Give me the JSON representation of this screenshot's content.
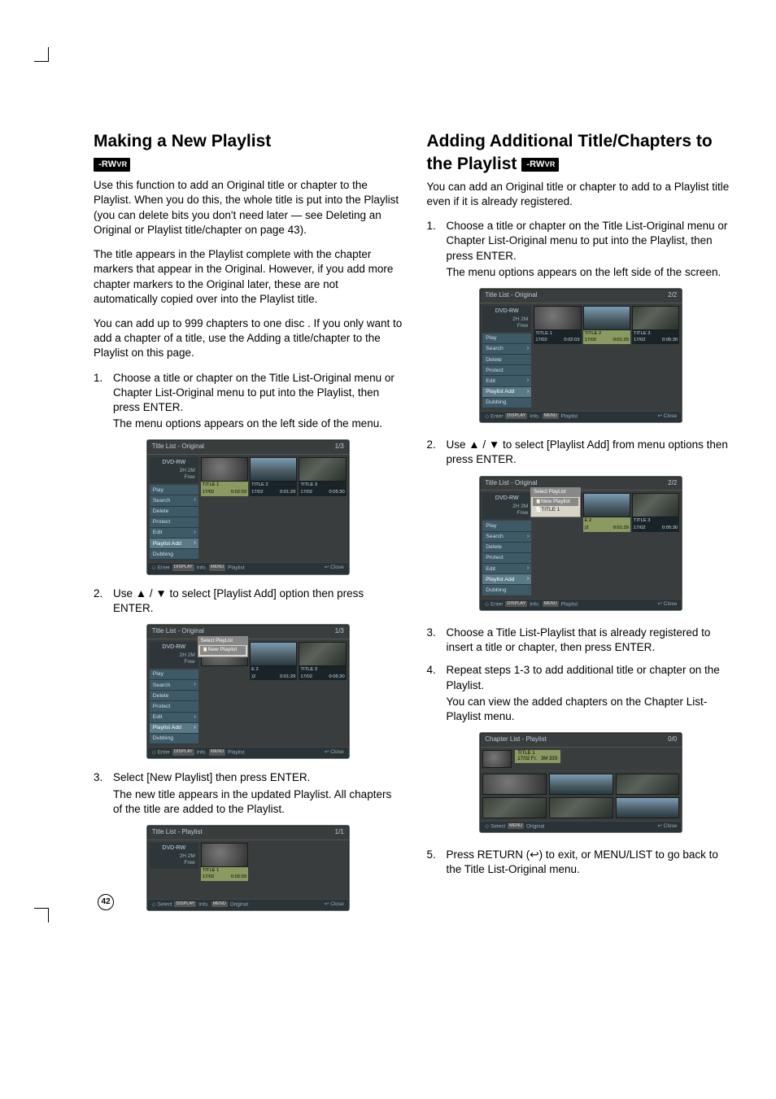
{
  "page_number": "42",
  "left": {
    "title": "Making a New Playlist",
    "badge": "-RW",
    "badge_sub": "VR",
    "p1": "Use this function to add an Original title or chapter to the Playlist. When you do this, the whole title is put into the Playlist (you can delete bits you don't need later — see Deleting an Original or Playlist title/chapter on page 43).",
    "p2": "The title appears in the Playlist complete with the chapter markers that appear in the Original. However, if you add more chapter markers to the Original later, these are not automatically copied over into the Playlist title.",
    "p3": "You can add up to 999 chapters to one disc . If you only want to add a chapter of a title, use the Adding a title/chapter to the Playlist on this page.",
    "step1_a": "Choose a title or chapter on the Title List-Original menu or Chapter List-Original menu to put into the Playlist, then press ENTER.",
    "step1_b": "The menu options appears on the left side of the menu.",
    "step2": "Use ▲ / ▼ to select [Playlist Add] option then press ENTER.",
    "step3_a": "Select [New Playlist] then press ENTER.",
    "step3_b": "The new title appears in the updated Playlist. All chapters of the title are added to the Playlist."
  },
  "right": {
    "title": "Adding Additional Title/Chapters to the Playlist",
    "badge": "-RW",
    "badge_sub": "VR",
    "p1": "You can add an Original title or chapter to add to a Playlist title even if it is already registered.",
    "step1_a": "Choose a title or chapter on the Title List-Original menu or Chapter List-Original menu to put into the Playlist, then press ENTER.",
    "step1_b": "The menu options appears on the left side of the screen.",
    "step2": "Use ▲ / ▼ to select [Playlist Add] from menu options then press ENTER.",
    "step3": "Choose a Title List-Playlist that is already registered to insert a title or chapter, then press ENTER.",
    "step4_a": "Repeat steps 1-3 to add additional title or chapter on the Playlist.",
    "step4_b": "You can view the added chapters on the Chapter List-Playlist menu.",
    "step5": "Press RETURN (↩) to exit, or MENU/LIST to go back to the Title List-Original menu."
  },
  "ui": {
    "titleListOriginal": "Title List - Original",
    "titleListPlaylist": "Title List - Playlist",
    "chapterListPlaylist": "Chapter List - Playlist",
    "page_1_3": "1/3",
    "page_2_2": "2/2",
    "page_1_1": "1/1",
    "page_0_0": "0/0",
    "disc_type": "DVD-RW",
    "disc_space": "2H 2M",
    "disc_free": "Free",
    "menu_play": "Play",
    "menu_search": "Search",
    "menu_delete": "Delete",
    "menu_protect": "Protect",
    "menu_edit": "Edit",
    "menu_playlist_add": "Playlist Add",
    "menu_dubbing": "Dubbing",
    "popup_select_playlist": "Select PlayList",
    "popup_new_playlist": "New Playlist",
    "popup_title1": "TITLE 1",
    "title1": "TITLE 1",
    "title2": "TITLE 2",
    "title3": "TITLE 3",
    "date": "17/02",
    "dur1": "0:02:03",
    "dur2": "0:01:29",
    "dur3": "0:05:30",
    "chapter_title": "TITLE 1",
    "chapter_date_fr": "17/02 Fr.",
    "chapter_len": "3M 33S",
    "bottom_enter": "Enter",
    "bottom_info": "Info.",
    "bottom_playlist": "Playlist",
    "bottom_original": "Original",
    "bottom_close": "Close",
    "bottom_select": "Select",
    "hint_return": "RETURN",
    "hint_display": "DISPLAY",
    "hint_menu": "MENU"
  }
}
